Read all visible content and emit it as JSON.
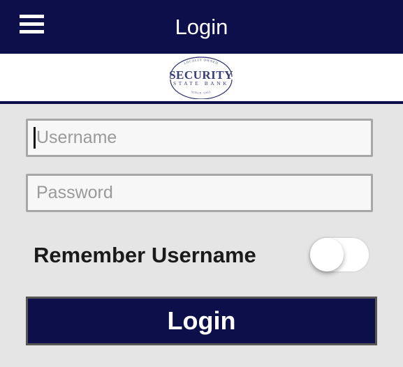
{
  "header": {
    "title": "Login",
    "menu_icon": "hamburger-menu-icon"
  },
  "logo": {
    "top_arc": "LOCALLY OWNED",
    "name": "SECURITY",
    "subtitle": "STATE BANK",
    "bottom_arc": "SINCE 1903"
  },
  "form": {
    "username": {
      "value": "",
      "placeholder": "Username"
    },
    "password": {
      "value": "",
      "placeholder": "Password"
    },
    "remember_label": "Remember Username",
    "remember_on": false,
    "login_label": "Login"
  },
  "colors": {
    "primary": "#0c0f4a",
    "background": "#e5e5e5",
    "field_bg": "#f7f7f7",
    "field_border": "#a7a7a7"
  }
}
